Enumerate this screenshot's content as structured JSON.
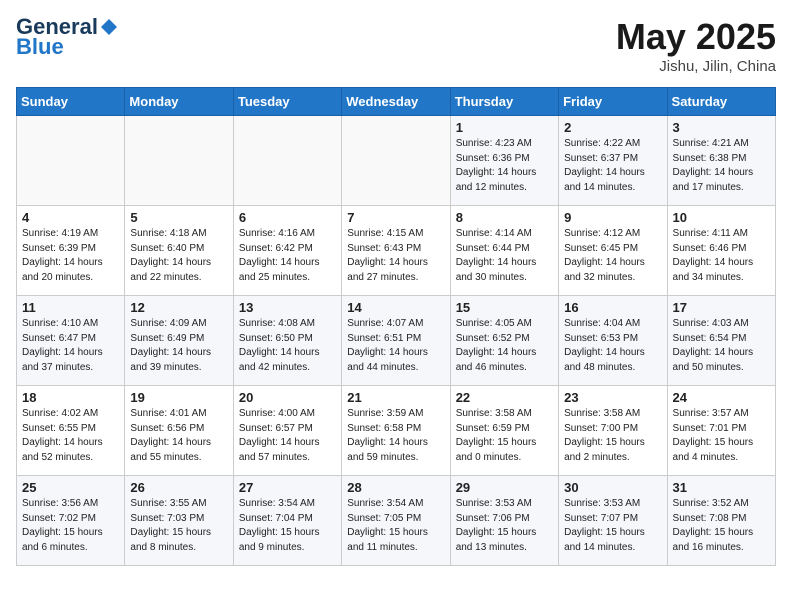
{
  "header": {
    "logo_general": "General",
    "logo_blue": "Blue",
    "title": "May 2025",
    "location": "Jishu, Jilin, China"
  },
  "days_of_week": [
    "Sunday",
    "Monday",
    "Tuesday",
    "Wednesday",
    "Thursday",
    "Friday",
    "Saturday"
  ],
  "weeks": [
    [
      {
        "day": "",
        "info": ""
      },
      {
        "day": "",
        "info": ""
      },
      {
        "day": "",
        "info": ""
      },
      {
        "day": "",
        "info": ""
      },
      {
        "day": "1",
        "info": "Sunrise: 4:23 AM\nSunset: 6:36 PM\nDaylight: 14 hours\nand 12 minutes."
      },
      {
        "day": "2",
        "info": "Sunrise: 4:22 AM\nSunset: 6:37 PM\nDaylight: 14 hours\nand 14 minutes."
      },
      {
        "day": "3",
        "info": "Sunrise: 4:21 AM\nSunset: 6:38 PM\nDaylight: 14 hours\nand 17 minutes."
      }
    ],
    [
      {
        "day": "4",
        "info": "Sunrise: 4:19 AM\nSunset: 6:39 PM\nDaylight: 14 hours\nand 20 minutes."
      },
      {
        "day": "5",
        "info": "Sunrise: 4:18 AM\nSunset: 6:40 PM\nDaylight: 14 hours\nand 22 minutes."
      },
      {
        "day": "6",
        "info": "Sunrise: 4:16 AM\nSunset: 6:42 PM\nDaylight: 14 hours\nand 25 minutes."
      },
      {
        "day": "7",
        "info": "Sunrise: 4:15 AM\nSunset: 6:43 PM\nDaylight: 14 hours\nand 27 minutes."
      },
      {
        "day": "8",
        "info": "Sunrise: 4:14 AM\nSunset: 6:44 PM\nDaylight: 14 hours\nand 30 minutes."
      },
      {
        "day": "9",
        "info": "Sunrise: 4:12 AM\nSunset: 6:45 PM\nDaylight: 14 hours\nand 32 minutes."
      },
      {
        "day": "10",
        "info": "Sunrise: 4:11 AM\nSunset: 6:46 PM\nDaylight: 14 hours\nand 34 minutes."
      }
    ],
    [
      {
        "day": "11",
        "info": "Sunrise: 4:10 AM\nSunset: 6:47 PM\nDaylight: 14 hours\nand 37 minutes."
      },
      {
        "day": "12",
        "info": "Sunrise: 4:09 AM\nSunset: 6:49 PM\nDaylight: 14 hours\nand 39 minutes."
      },
      {
        "day": "13",
        "info": "Sunrise: 4:08 AM\nSunset: 6:50 PM\nDaylight: 14 hours\nand 42 minutes."
      },
      {
        "day": "14",
        "info": "Sunrise: 4:07 AM\nSunset: 6:51 PM\nDaylight: 14 hours\nand 44 minutes."
      },
      {
        "day": "15",
        "info": "Sunrise: 4:05 AM\nSunset: 6:52 PM\nDaylight: 14 hours\nand 46 minutes."
      },
      {
        "day": "16",
        "info": "Sunrise: 4:04 AM\nSunset: 6:53 PM\nDaylight: 14 hours\nand 48 minutes."
      },
      {
        "day": "17",
        "info": "Sunrise: 4:03 AM\nSunset: 6:54 PM\nDaylight: 14 hours\nand 50 minutes."
      }
    ],
    [
      {
        "day": "18",
        "info": "Sunrise: 4:02 AM\nSunset: 6:55 PM\nDaylight: 14 hours\nand 52 minutes."
      },
      {
        "day": "19",
        "info": "Sunrise: 4:01 AM\nSunset: 6:56 PM\nDaylight: 14 hours\nand 55 minutes."
      },
      {
        "day": "20",
        "info": "Sunrise: 4:00 AM\nSunset: 6:57 PM\nDaylight: 14 hours\nand 57 minutes."
      },
      {
        "day": "21",
        "info": "Sunrise: 3:59 AM\nSunset: 6:58 PM\nDaylight: 14 hours\nand 59 minutes."
      },
      {
        "day": "22",
        "info": "Sunrise: 3:58 AM\nSunset: 6:59 PM\nDaylight: 15 hours\nand 0 minutes."
      },
      {
        "day": "23",
        "info": "Sunrise: 3:58 AM\nSunset: 7:00 PM\nDaylight: 15 hours\nand 2 minutes."
      },
      {
        "day": "24",
        "info": "Sunrise: 3:57 AM\nSunset: 7:01 PM\nDaylight: 15 hours\nand 4 minutes."
      }
    ],
    [
      {
        "day": "25",
        "info": "Sunrise: 3:56 AM\nSunset: 7:02 PM\nDaylight: 15 hours\nand 6 minutes."
      },
      {
        "day": "26",
        "info": "Sunrise: 3:55 AM\nSunset: 7:03 PM\nDaylight: 15 hours\nand 8 minutes."
      },
      {
        "day": "27",
        "info": "Sunrise: 3:54 AM\nSunset: 7:04 PM\nDaylight: 15 hours\nand 9 minutes."
      },
      {
        "day": "28",
        "info": "Sunrise: 3:54 AM\nSunset: 7:05 PM\nDaylight: 15 hours\nand 11 minutes."
      },
      {
        "day": "29",
        "info": "Sunrise: 3:53 AM\nSunset: 7:06 PM\nDaylight: 15 hours\nand 13 minutes."
      },
      {
        "day": "30",
        "info": "Sunrise: 3:53 AM\nSunset: 7:07 PM\nDaylight: 15 hours\nand 14 minutes."
      },
      {
        "day": "31",
        "info": "Sunrise: 3:52 AM\nSunset: 7:08 PM\nDaylight: 15 hours\nand 16 minutes."
      }
    ]
  ]
}
